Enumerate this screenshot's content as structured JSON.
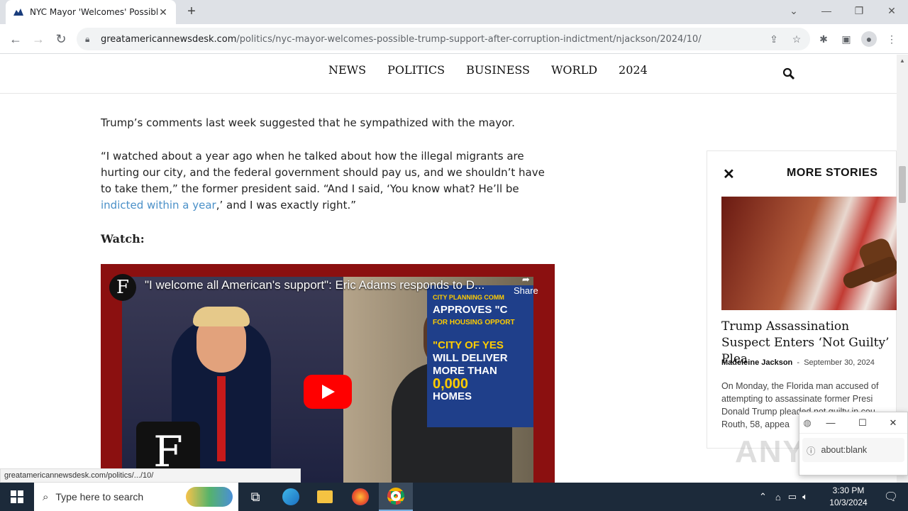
{
  "browser": {
    "tab_title": "NYC Mayor 'Welcomes' Possible",
    "new_tab": "+",
    "url_domain": "greatamericannewsdesk.com",
    "url_path": "/politics/nyc-mayor-welcomes-possible-trump-support-after-corruption-indictment/njackson/2024/10/",
    "status_url": "greatamericannewsdesk.com/politics/.../10/"
  },
  "site_nav": {
    "items": [
      "NEWS",
      "POLITICS",
      "BUSINESS",
      "WORLD",
      "2024"
    ]
  },
  "article": {
    "p1": "Trump’s comments last week suggested that he sympathized with the mayor.",
    "p2_start": "“I watched about a year ago when he talked about how the illegal migrants are hurting our city, and the federal government should pay us, and we shouldn’t have to take them,” the former president said. “And I said, ‘You know what? He’ll be ",
    "p2_link": "indicted within a year",
    "p2_end": ",’ and I was exactly right.”",
    "watch_label": "Watch:"
  },
  "video": {
    "title": "\"I welcome all American's support\": Eric Adams responds to D...",
    "share_label": "Share",
    "sign_line1": "CITY PLANNING COMM",
    "sign_line2": "APPROVES \"C",
    "sign_line3": "FOR HOUSING OPPORT",
    "sign_line4": "\"CITY OF YES",
    "sign_line5": "WILL DELIVER",
    "sign_line6": "MORE THAN",
    "sign_line7": "0,000",
    "sign_line8": "HOMES",
    "logo_letter": "F"
  },
  "more_stories": {
    "header": "MORE STORIES",
    "title": "Trump Assassination Suspect Enters ‘Not Guilty’ Plea",
    "author": "Madeleine Jackson",
    "separator": "-",
    "date": "September 30, 2024",
    "excerpt_l1": "On Monday, the Florida man accused of",
    "excerpt_l2": "attempting to assassinate former Presi",
    "excerpt_l3": "Donald Trump pleaded not guilty in cou",
    "excerpt_l4": "Routh, 58, appea"
  },
  "popup": {
    "address": "about:blank"
  },
  "taskbar": {
    "search_placeholder": "Type here to search",
    "time": "3:30 PM",
    "date": "10/3/2024"
  },
  "watermark": "ANY RUN"
}
